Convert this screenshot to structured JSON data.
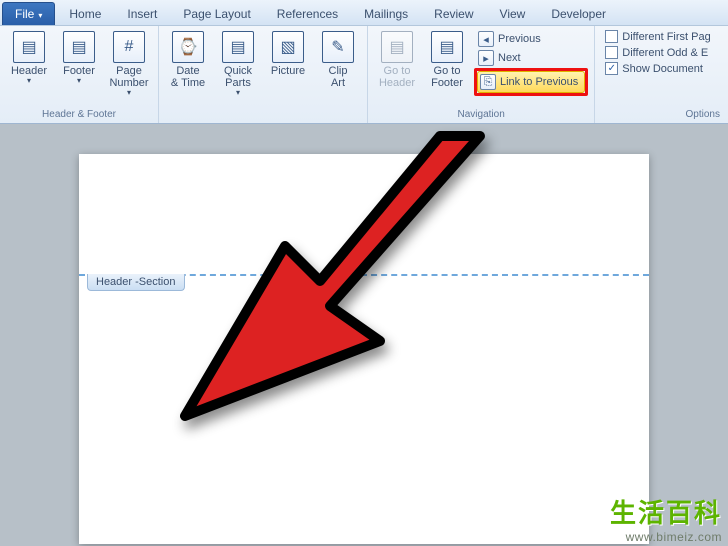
{
  "tabs": {
    "file": "File",
    "home": "Home",
    "insert": "Insert",
    "page_layout": "Page Layout",
    "references": "References",
    "mailings": "Mailings",
    "review": "Review",
    "view": "View",
    "developer": "Developer"
  },
  "ribbon": {
    "group_hf": {
      "label": "Header & Footer",
      "header": "Header",
      "footer": "Footer",
      "page_number": "Page\nNumber"
    },
    "group_insert": {
      "date_time": "Date\n& Time",
      "quick_parts": "Quick\nParts",
      "picture": "Picture",
      "clip_art": "Clip\nArt"
    },
    "group_nav": {
      "label": "Navigation",
      "goto_header": "Go to\nHeader",
      "goto_footer": "Go to\nFooter",
      "previous": "Previous",
      "next": "Next",
      "link_prev": "Link to Previous"
    },
    "group_options": {
      "label": "Options",
      "diff_first": "Different First Pag",
      "diff_odd": "Different Odd & E",
      "show_doc": "Show Document "
    }
  },
  "doc": {
    "header_tab": "Header -Section"
  },
  "watermark": {
    "cn": "生活百科",
    "url": "www.bimeiz.com"
  },
  "icons": {
    "header": "▤",
    "footer": "▤",
    "page_number": "#",
    "date": "⌚",
    "quick": "▤",
    "picture": "▧",
    "clip": "✎",
    "goto_h": "▤",
    "goto_f": "▤",
    "prev": "◂",
    "next": "▸",
    "link": "⎘",
    "check": "✓"
  }
}
